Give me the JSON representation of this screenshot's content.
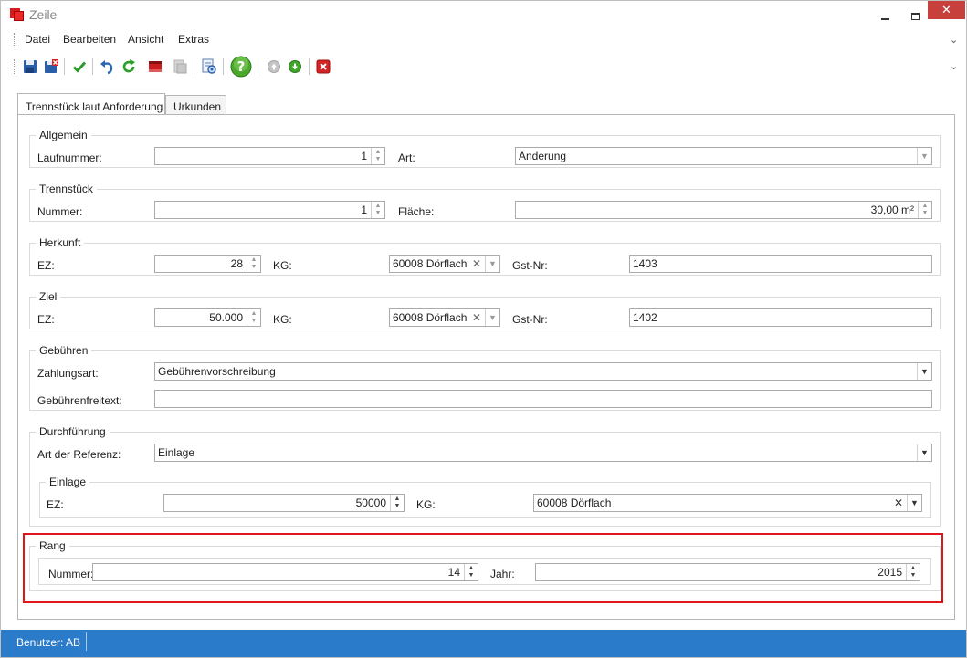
{
  "window": {
    "title": "Zeile"
  },
  "menu": {
    "items": [
      "Datei",
      "Bearbeiten",
      "Ansicht",
      "Extras"
    ]
  },
  "toolbar": {
    "buttons": [
      "save-icon",
      "save-close-icon",
      "check-icon",
      "undo-icon",
      "refresh-icon",
      "delete-record-icon",
      "print-preview-icon",
      "document-view-icon",
      "help-icon",
      "up-icon",
      "down-icon",
      "close-record-icon"
    ]
  },
  "tabs": [
    {
      "label": "Trennstück laut Anforderung"
    },
    {
      "label": "Urkunden"
    }
  ],
  "allgemein": {
    "title": "Allgemein",
    "laufnummer_label": "Laufnummer:",
    "laufnummer_value": "1",
    "art_label": "Art:",
    "art_value": "Änderung"
  },
  "trennstueck": {
    "title": "Trennstück",
    "nummer_label": "Nummer:",
    "nummer_value": "1",
    "flaeche_label": "Fläche:",
    "flaeche_value": "30,00 m²"
  },
  "herkunft": {
    "title": "Herkunft",
    "ez_label": "EZ:",
    "ez_value": "28",
    "kg_label": "KG:",
    "kg_value": "60008 Dörflach",
    "gst_label": "Gst-Nr:",
    "gst_value": "1403"
  },
  "ziel": {
    "title": "Ziel",
    "ez_label": "EZ:",
    "ez_value": "50.000",
    "kg_label": "KG:",
    "kg_value": "60008 Dörflach",
    "gst_label": "Gst-Nr:",
    "gst_value": "1402"
  },
  "gebuehren": {
    "title": "Gebühren",
    "zahlungsart_label": "Zahlungsart:",
    "zahlungsart_value": "Gebührenvorschreibung",
    "freitext_label": "Gebührenfreitext:",
    "freitext_value": ""
  },
  "durchfuehrung": {
    "title": "Durchführung",
    "referenz_label": "Art der Referenz:",
    "referenz_value": "Einlage",
    "einlage": {
      "title": "Einlage",
      "ez_label": "EZ:",
      "ez_value": "50000",
      "kg_label": "KG:",
      "kg_value": "60008 Dörflach"
    }
  },
  "rang": {
    "title": "Rang",
    "nummer_label": "Nummer:",
    "nummer_value": "14",
    "jahr_label": "Jahr:",
    "jahr_value": "2015"
  },
  "status": {
    "user": "Benutzer: AB"
  },
  "colors": {
    "accent": "#2a7ccb",
    "highlight": "#e0161b",
    "close": "#c7403b"
  }
}
